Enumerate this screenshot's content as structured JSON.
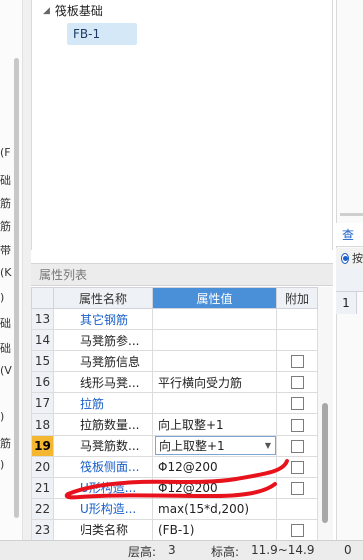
{
  "left_panel": {
    "texts": [
      "(F",
      "础",
      "筋",
      "筋",
      "带",
      "(K",
      ")",
      "础",
      "础",
      "(V",
      ")",
      "筋",
      ")"
    ]
  },
  "tree": {
    "root_label": "筏板基础",
    "child_label": "FB-1"
  },
  "properties": {
    "header": "属性列表",
    "columns": {
      "name": "属性名称",
      "value": "属性值",
      "add": "附加"
    },
    "rows": [
      {
        "num": "13",
        "name": "其它钢筋",
        "value": "",
        "blue": true,
        "checkbox": false
      },
      {
        "num": "14",
        "name": "马凳筋参...",
        "value": "",
        "blue": false,
        "checkbox": false
      },
      {
        "num": "15",
        "name": "马凳筋信息",
        "value": "",
        "blue": false,
        "checkbox": true
      },
      {
        "num": "16",
        "name": "线形马凳...",
        "value": "平行横向受力筋",
        "blue": false,
        "checkbox": true
      },
      {
        "num": "17",
        "name": "拉筋",
        "value": "",
        "blue": true,
        "checkbox": true
      },
      {
        "num": "18",
        "name": "拉筋数量...",
        "value": "向上取整+1",
        "blue": false,
        "checkbox": true
      },
      {
        "num": "19",
        "name": "马凳筋数...",
        "value": "向上取整+1",
        "blue": false,
        "checkbox": true,
        "active": true,
        "dropdown": true
      },
      {
        "num": "20",
        "name": "筏板侧面...",
        "value": "Φ12@200",
        "blue": true,
        "checkbox": true
      },
      {
        "num": "21",
        "name": "U形构造...",
        "value": "Φ12@200",
        "blue": true,
        "checkbox": true
      },
      {
        "num": "22",
        "name": "U形构造...",
        "value": "max(15*d,200)",
        "blue": true,
        "checkbox": false
      },
      {
        "num": "23",
        "name": "归类名称",
        "value": "(FB-1)",
        "blue": false,
        "checkbox": true
      }
    ]
  },
  "right_panel": {
    "query_tab": "查询",
    "radio_label": "按",
    "row_num": "1"
  },
  "status_bar": {
    "floor_label": "层高:",
    "floor_value": "3",
    "elevation_label": "标高:",
    "elevation_value": "11.9~14.9",
    "extra_value": "0"
  },
  "colors": {
    "accent": "#4a90d9",
    "active_row": "#f5b631",
    "link_blue": "#1a5fc9",
    "scribble": "#e8121c"
  }
}
